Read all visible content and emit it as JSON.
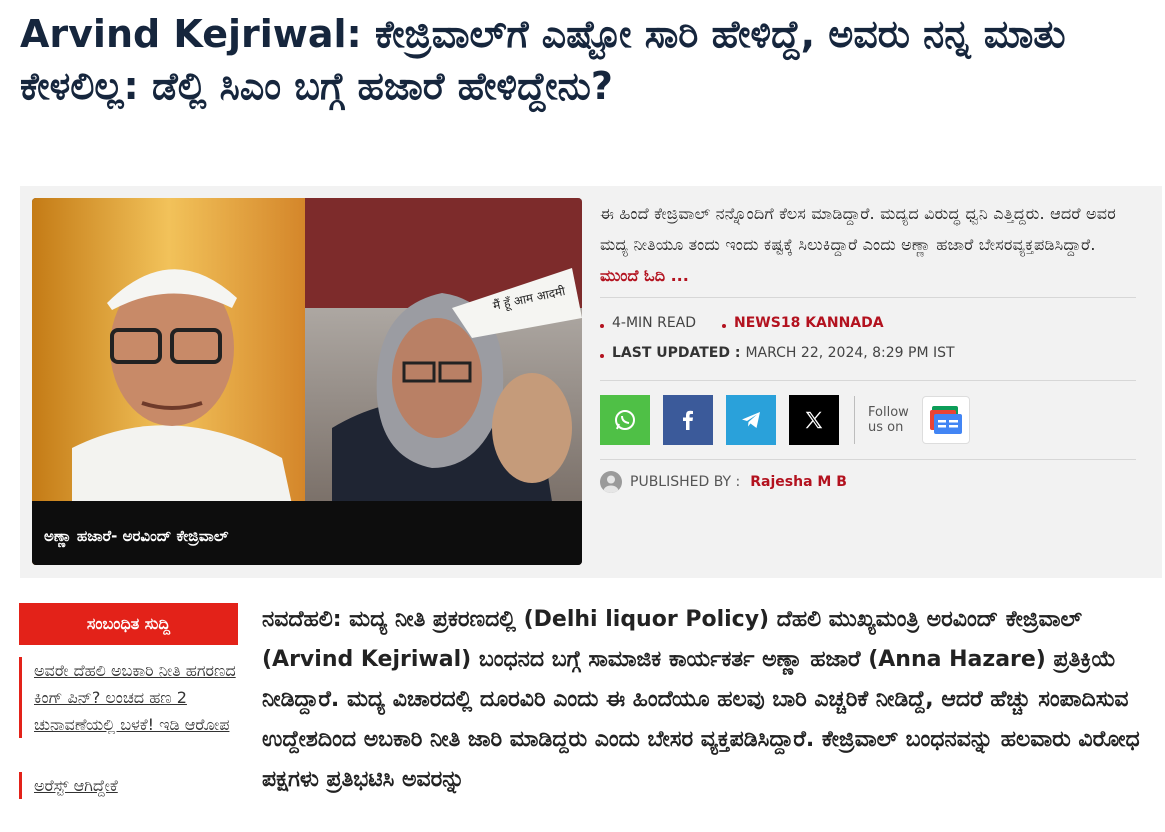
{
  "headline": "Arvind Kejriwal: ಕೇಜ್ರಿವಾಲ್‌ಗೆ ಎಷ್ಟೋ ಸಾರಿ ಹೇಳಿದ್ದೆ, ಅವರು ನನ್ನ ಮಾತು ಕೇಳಲಿಲ್ಲ: ಡೆಲ್ಲಿ ಸಿಎಂ ಬಗ್ಗೆ ಹಜಾರೆ ಹೇಳಿದ್ದೇನು?",
  "hero": {
    "caption": "ಅಣ್ಣಾ ಹಜಾರೆ- ಅರವಿಂದ್ ಕೇಜ್ರಿವಾಲ್",
    "cap_badge_text": "मैं हूँ आम आदमी",
    "summary": "ಈ ಹಿಂದೆ ಕೇಜ್ರಿವಾಲ್ ನನ್ನೊಂದಿಗೆ ಕೆಲಸ ಮಾಡಿದ್ದಾರೆ. ಮದ್ಯದ ವಿರುದ್ಧ ಧ್ವನಿ ಎತ್ತಿದ್ದರು. ಆದರೆ ಅವರ ಮದ್ಯ ನೀತಿಯೂ ತಂದು ಇಂದು ಕಷ್ಟಕ್ಕೆ ಸಿಲುಕಿದ್ದಾರೆ ಎಂದು ಅಣ್ಣಾ ಹಜಾರೆ ಬೇಸರವ್ಯಕ್ತಪಡಿಸಿದ್ದಾರೆ.",
    "read_more": "ಮುಂದೆ ಓದಿ ..."
  },
  "meta": {
    "read_time": "4-MIN READ",
    "source": "NEWS18 KANNADA",
    "updated_label": "LAST UPDATED :",
    "updated_value": "MARCH 22, 2024, 8:29 PM IST"
  },
  "share": {
    "follow_line1": "Follow",
    "follow_line2": "us on",
    "icons": [
      "whatsapp-icon",
      "facebook-icon",
      "telegram-icon",
      "x-icon",
      "google-news-icon"
    ],
    "colors": {
      "whatsapp": "#4fc046",
      "facebook": "#3b5a9a",
      "telegram": "#2aa1da",
      "x": "#000000"
    }
  },
  "publisher": {
    "label": "PUBLISHED BY :",
    "name": "Rajesha M B"
  },
  "sidebar": {
    "title": "ಸಂಬಂಧಿತ ಸುದ್ದಿ",
    "items": [
      "ಅವರೇ ದೆಹಲಿ ಅಬಕಾರಿ ನೀತಿ ಹಗರಣದ ಕಿಂಗ್ ಪಿನ್? ಲಂಚದ ಹಣ 2 ಚುನಾವಣೆಯಲ್ಲಿ ಬಳಕೆ! ಇಡಿ ಆರೋಪ",
      "ಅರೆಸ್ಟ್ ಆಗಿದ್ದೇಕೆ"
    ]
  },
  "article": {
    "body": "ನವದೆಹಲಿ: ಮದ್ಯ ನೀತಿ ಪ್ರಕರಣದಲ್ಲಿ (Delhi liquor Policy) ದೆಹಲಿ ಮುಖ್ಯಮಂತ್ರಿ ಅರವಿಂದ್ ಕೇಜ್ರಿವಾಲ್ (Arvind Kejriwal) ಬಂಧನದ ಬಗ್ಗೆ ಸಾಮಾಜಿಕ ಕಾರ್ಯಕರ್ತ ಅಣ್ಣಾ ಹಜಾರೆ (Anna Hazare) ಪ್ರತಿಕ್ರಿಯೆ ನೀಡಿದ್ದಾರೆ. ಮದ್ಯ ವಿಚಾರದಲ್ಲಿ ದೂರವಿರಿ ಎಂದು ಈ ಹಿಂದೆಯೂ ಹಲವು ಬಾರಿ ಎಚ್ಚರಿಕೆ ನೀಡಿದ್ದೆ, ಆದರೆ ಹೆಚ್ಚು ಸಂಪಾದಿಸುವ ಉದ್ದೇಶದಿಂದ ಅಬಕಾರಿ ನೀತಿ ಜಾರಿ ಮಾಡಿದ್ದರು ಎಂದು ಬೇಸರ ವ್ಯಕ್ತಪಡಿಸಿದ್ದಾರೆ. ಕೇಜ್ರಿವಾಲ್ ಬಂಧನವನ್ನು ಹಲವಾರು ವಿರೋಧ ಪಕ್ಷಗಳು ಪ್ರತಿಭಟಿಸಿ ಅವರನ್ನು"
  }
}
